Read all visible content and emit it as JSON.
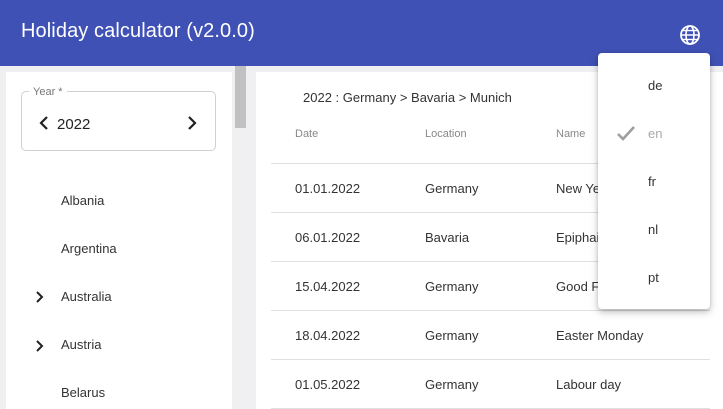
{
  "app": {
    "title": "Holiday calculator (v2.0.0)",
    "accent": "#3f51b5"
  },
  "year": {
    "label": "Year *",
    "value": "2022"
  },
  "countries": [
    {
      "name": "Albania",
      "expandable": false
    },
    {
      "name": "Argentina",
      "expandable": false
    },
    {
      "name": "Australia",
      "expandable": true
    },
    {
      "name": "Austria",
      "expandable": true
    },
    {
      "name": "Belarus",
      "expandable": false
    }
  ],
  "breadcrumb": "2022 : Germany > Bavaria > Munich",
  "table": {
    "headers": [
      "Date",
      "Location",
      "Name"
    ],
    "rows": [
      {
        "date": "01.01.2022",
        "location": "Germany",
        "name": "New Ye"
      },
      {
        "date": "06.01.2022",
        "location": "Bavaria",
        "name": "Epiphai"
      },
      {
        "date": "15.04.2022",
        "location": "Germany",
        "name": "Good F"
      },
      {
        "date": "18.04.2022",
        "location": "Germany",
        "name": "Easter Monday"
      },
      {
        "date": "01.05.2022",
        "location": "Germany",
        "name": "Labour day"
      }
    ]
  },
  "language_menu": {
    "items": [
      {
        "code": "de",
        "selected": false
      },
      {
        "code": "en",
        "selected": true
      },
      {
        "code": "fr",
        "selected": false
      },
      {
        "code": "nl",
        "selected": false
      },
      {
        "code": "pt",
        "selected": false
      }
    ]
  }
}
